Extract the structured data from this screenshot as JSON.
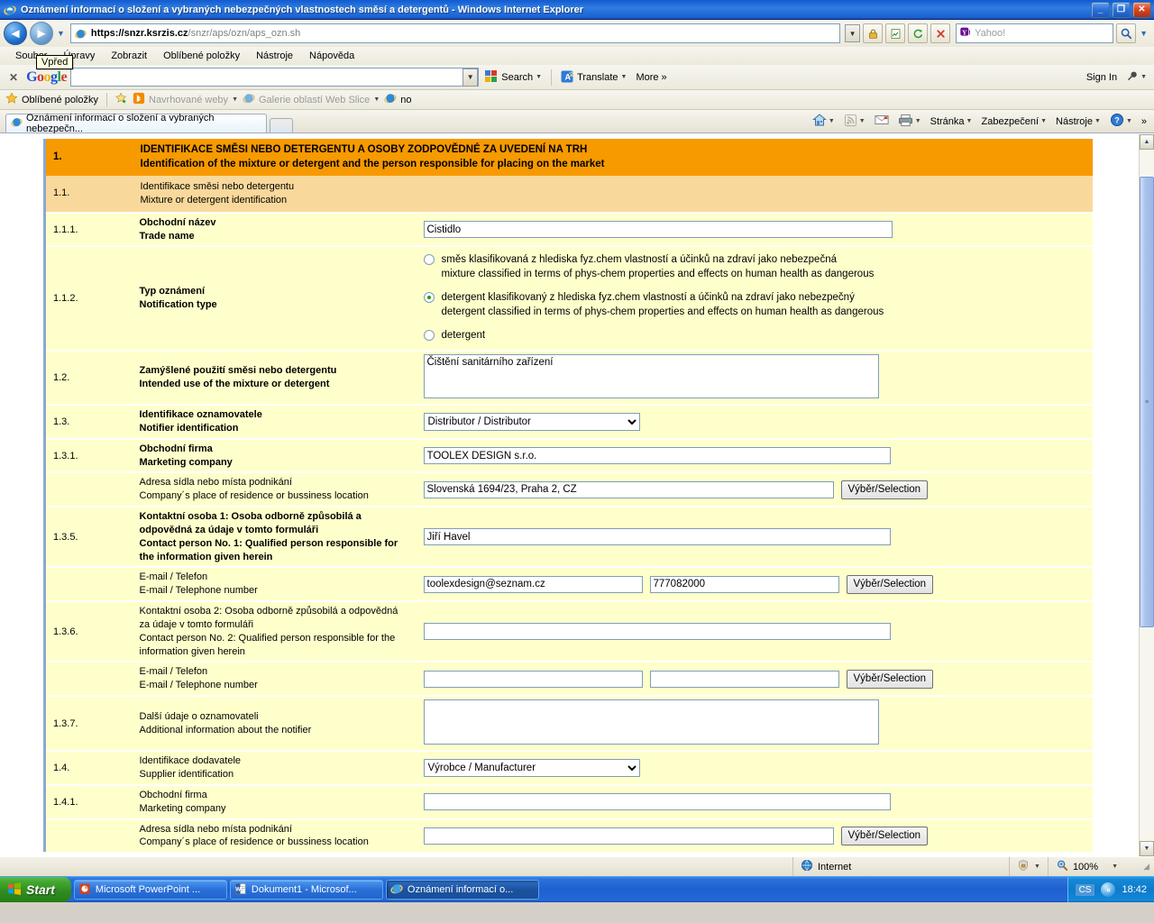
{
  "window": {
    "title": "Oznámení informací o složení a vybraných nebezpečných vlastnostech směsí a detergentů - Windows Internet Explorer",
    "minimize_label": "_",
    "maximize_label": "❐",
    "close_label": "✕"
  },
  "navigation": {
    "back_label": "◄",
    "forward_label": "►",
    "history_dropdown_label": "▼",
    "address_protocol": "https://",
    "address_domain": "snzr.ksrzis.cz",
    "address_path": "/snzr/aps/ozn/aps_ozn.sh",
    "address_full": "https://snzr.ksrzis.cz/snzr/aps/ozn/aps_ozn.sh",
    "search_placeholder": "Yahoo!",
    "search_go_label": "🔍"
  },
  "menu": {
    "items": [
      {
        "label": "Soubor"
      },
      {
        "label": "Úpravy"
      },
      {
        "label": "Zobrazit"
      },
      {
        "label": "Oblíbené položky"
      },
      {
        "label": "Nástroje"
      },
      {
        "label": "Nápověda"
      }
    ],
    "tooltip": "Vpřed"
  },
  "google_toolbar": {
    "close_label": "✕",
    "logo": [
      "G",
      "o",
      "o",
      "g",
      "l",
      "e"
    ],
    "search_value": "",
    "search_label": "Search",
    "translate_label": "Translate",
    "more_label": "More",
    "more_chevron": "»",
    "sign_in_label": "Sign In",
    "settings_label": "🔧"
  },
  "favorites_bar": {
    "favorites_label": "Oblíbené položky",
    "items": [
      {
        "label": "Navrhované weby",
        "icon": "bing-icon",
        "dropdown": true
      },
      {
        "label": "Galerie oblastí Web Slice",
        "icon": "ie-icon",
        "dropdown": true
      },
      {
        "label": "no",
        "icon": "ie-icon",
        "dropdown": false
      }
    ]
  },
  "tabs": [
    {
      "label": "Oznámení informací o složení a vybraných nebezpečn...",
      "active": true
    }
  ],
  "command_bar": {
    "items": [
      {
        "label": "",
        "icon": "home-icon",
        "dropdown": true,
        "gray": false
      },
      {
        "label": "",
        "icon": "feeds-icon",
        "dropdown": true,
        "gray": true
      },
      {
        "label": "",
        "icon": "mail-icon",
        "dropdown": false,
        "gray": false
      },
      {
        "label": "",
        "icon": "print-icon",
        "dropdown": true,
        "gray": false
      },
      {
        "label": "Stránka",
        "icon": "",
        "dropdown": true,
        "gray": false
      },
      {
        "label": "Zabezpečení",
        "icon": "",
        "dropdown": true,
        "gray": false
      },
      {
        "label": "Nástroje",
        "icon": "",
        "dropdown": true,
        "gray": false
      },
      {
        "label": "",
        "icon": "help-icon",
        "dropdown": true,
        "gray": false
      }
    ],
    "overflow_label": "»"
  },
  "form": {
    "section_header": {
      "number": "1.",
      "cs": "IDENTIFIKACE SMĚSI NEBO DETERGENTU A OSOBY ZODPOVĚDNÉ ZA UVEDENÍ NA TRH",
      "en": "Identification of the mixture or detergent and the person responsible for placing on the market"
    },
    "subsection": {
      "number": "1.1.",
      "cs": "Identifikace směsi nebo detergentu",
      "en": "Mixture or detergent identification"
    },
    "rows": {
      "trade_name": {
        "number": "1.1.1.",
        "cs": "Obchodní název",
        "en": "Trade name",
        "value": "Čistidlo"
      },
      "notification_type": {
        "number": "1.1.2.",
        "cs": "Typ oznámení",
        "en": "Notification type",
        "options": [
          {
            "cs": "směs klasifikovaná z hlediska fyz.chem vlastností a účinků na zdraví jako nebezpečná",
            "en": "mixture classified in terms of phys-chem properties and effects on human health as dangerous",
            "selected": false
          },
          {
            "cs": "detergent klasifikovaný z hlediska fyz.chem vlastností a účinků na zdraví jako nebezpečný",
            "en": "detergent classified in terms of phys-chem properties and effects on human health as dangerous",
            "selected": true
          },
          {
            "cs": "detergent",
            "en": "",
            "selected": false
          }
        ]
      },
      "intended_use": {
        "number": "1.2.",
        "cs": "Zamýšlené použití směsi nebo detergentu",
        "en": "Intended use of the mixture or detergent",
        "value": "Čištění sanitárního zařízení"
      },
      "notifier_identification": {
        "number": "1.3.",
        "cs": "Identifikace oznamovatele",
        "en": "Notifier identification",
        "value": "Distributor / Distributor"
      },
      "marketing_company_notifier": {
        "number": "1.3.1.",
        "cs": "Obchodní firma",
        "en": "Marketing company",
        "value": "TOOLEX DESIGN s.r.o."
      },
      "address_notifier": {
        "number": "",
        "cs": "Adresa sídla nebo místa podnikání",
        "en": "Company´s place of residence or bussiness location",
        "value": "Slovenská 1694/23, Praha 2, CZ",
        "button": "Výběr/Selection"
      },
      "contact_person_1": {
        "number": "1.3.5.",
        "cs": "Kontaktní osoba 1: Osoba odborně způsobilá a odpovědná za údaje v tomto formuláři",
        "en": "Contact person No. 1: Qualified person responsible for the information given herein",
        "value": "Jiří Havel"
      },
      "contact_1_email_phone": {
        "number": "",
        "cs": "E-mail / Telefon",
        "en": "E-mail / Telephone number",
        "email": "toolexdesign@seznam.cz",
        "phone": "777082000",
        "button": "Výběr/Selection"
      },
      "contact_person_2": {
        "number": "1.3.6.",
        "cs": "Kontaktní osoba 2: Osoba odborně způsobilá a odpovědná za údaje v tomto formuláři",
        "en": "Contact person No. 2: Qualified person responsible for the information given herein",
        "value": ""
      },
      "contact_2_email_phone": {
        "number": "",
        "cs": "E-mail / Telefon",
        "en": "E-mail / Telephone number",
        "email": "",
        "phone": "",
        "button": "Výběr/Selection"
      },
      "additional_info": {
        "number": "1.3.7.",
        "cs": "Další údaje o oznamovateli",
        "en": "Additional information about the notifier",
        "value": ""
      },
      "supplier_identification": {
        "number": "1.4.",
        "cs": "Identifikace dodavatele",
        "en": "Supplier identification",
        "value": "Výrobce / Manufacturer"
      },
      "marketing_company_supplier": {
        "number": "1.4.1.",
        "cs": "Obchodní firma",
        "en": "Marketing company",
        "value": ""
      },
      "address_supplier": {
        "number": "",
        "cs": "Adresa sídla nebo místa podnikání",
        "en": "Company´s place of residence or bussiness location",
        "value": "",
        "button": "Výběr/Selection"
      }
    }
  },
  "status_bar": {
    "zone": "Internet",
    "zone_icon": "globe-icon",
    "protected_mode_icon": "shield-icon",
    "zoom": "100%",
    "zoom_icon": "magnifier-icon",
    "dropdown": "▼"
  },
  "taskbar": {
    "start_label": "Start",
    "items": [
      {
        "label": "Microsoft PowerPoint ...",
        "icon": "powerpoint-icon",
        "active": false
      },
      {
        "label": "Dokument1 - Microsof...",
        "icon": "word-icon",
        "active": false
      },
      {
        "label": "Oznámení informací o...",
        "icon": "ie-icon",
        "active": true
      }
    ],
    "language": "CS",
    "clock": "18:42"
  },
  "colors": {
    "header_orange": "#F79A00",
    "subheader_orange": "#F9D99B",
    "row_cream": "#FFFFCC",
    "title_blue": "#2F7DE1",
    "radio_selected_green": "#1C9C1C"
  }
}
